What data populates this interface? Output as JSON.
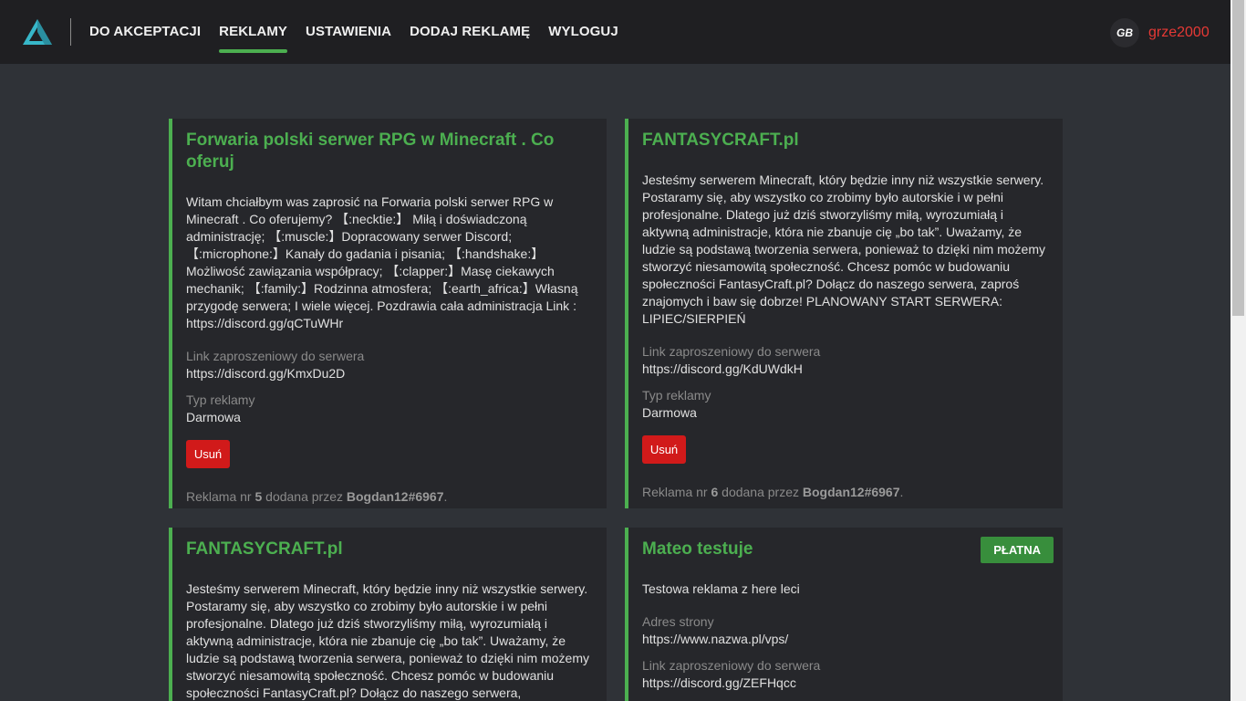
{
  "nav": {
    "links": [
      "DO AKCEPTACJI",
      "REKLAMY",
      "USTAWIENIA",
      "DODAJ REKLAMĘ",
      "WYLOGUJ"
    ],
    "active_index": 1,
    "avatar_text": "GB",
    "username": "grze2000"
  },
  "colors": {
    "accent": "#4caf50",
    "danger": "#d11a1a",
    "username": "#e53935",
    "background": "#2f3237",
    "card": "#26272b"
  },
  "cards": [
    {
      "title": "Forwaria polski serwer RPG w Minecraft . Co oferuj",
      "description": "Witam chciałbym was zaprosić na Forwaria polski serwer RPG w Minecraft . Co oferujemy? 【:necktie:】 Miłą i doświadczoną administrację; 【:muscle:】Dopracowany serwer Discord; 【:microphone:】Kanały do gadania i pisania; 【:handshake:】 Możliwość zawiązania współpracy; 【:clapper:】Masę ciekawych mechanik; 【:family:】Rodzinna atmosfera; 【:earth_africa:】Własną przygodę serwera; I wiele więcej. Pozdrawia cała administracja Link : https://discord.gg/qCTuWHr",
      "link_label": "Link zaproszeniowy do serwera",
      "link_value": "https://discord.gg/KmxDu2D",
      "type_label": "Typ reklamy",
      "type_value": "Darmowa",
      "delete_label": "Usuń",
      "footer_prefix": "Reklama nr ",
      "number": "5",
      "footer_mid": " dodana przez ",
      "author": "Bogdan12#6967",
      "footer_suffix": "."
    },
    {
      "title": "FANTASYCRAFT.pl",
      "description": "Jesteśmy serwerem Minecraft, który będzie inny niż wszystkie serwery. Postaramy się, aby wszystko co zrobimy było autorskie i w pełni profesjonalne. Dlatego już dziś stworzyliśmy miłą, wyrozumiałą i aktywną administracje, która nie zbanuje cię „bo tak”. Uważamy, że ludzie są podstawą tworzenia serwera, ponieważ to dzięki nim możemy stworzyć niesamowitą społeczność. Chcesz pomóc w budowaniu społeczności FantasyCraft.pl? Dołącz do naszego serwera, zaproś znajomych i baw się dobrze! PLANOWANY START SERWERA: LIPIEC/SIERPIEŃ",
      "link_label": "Link zaproszeniowy do serwera",
      "link_value": "https://discord.gg/KdUWdkH",
      "type_label": "Typ reklamy",
      "type_value": "Darmowa",
      "delete_label": "Usuń",
      "footer_prefix": "Reklama nr ",
      "number": "6",
      "footer_mid": " dodana przez ",
      "author": "Bogdan12#6967",
      "footer_suffix": "."
    },
    {
      "title": "FANTASYCRAFT.pl",
      "description": "Jesteśmy serwerem Minecraft, który będzie inny niż wszystkie serwery. Postaramy się, aby wszystko co zrobimy było autorskie i w pełni profesjonalne. Dlatego już dziś stworzyliśmy miłą, wyrozumiałą i aktywną administracje, która nie zbanuje cię „bo tak”. Uważamy, że ludzie są podstawą tworzenia serwera, ponieważ to dzięki nim możemy stworzyć niesamowitą społeczność. Chcesz pomóc w budowaniu społeczności FantasyCraft.pl? Dołącz do naszego serwera,"
    },
    {
      "title": "Mateo testuje",
      "badge": "PŁATNA",
      "description": "Testowa reklama z here leci",
      "site_label": "Adres strony",
      "site_value": "https://www.nazwa.pl/vps/",
      "link_label": "Link zaproszeniowy do serwera",
      "link_value": "https://discord.gg/ZEFHqcc"
    }
  ]
}
